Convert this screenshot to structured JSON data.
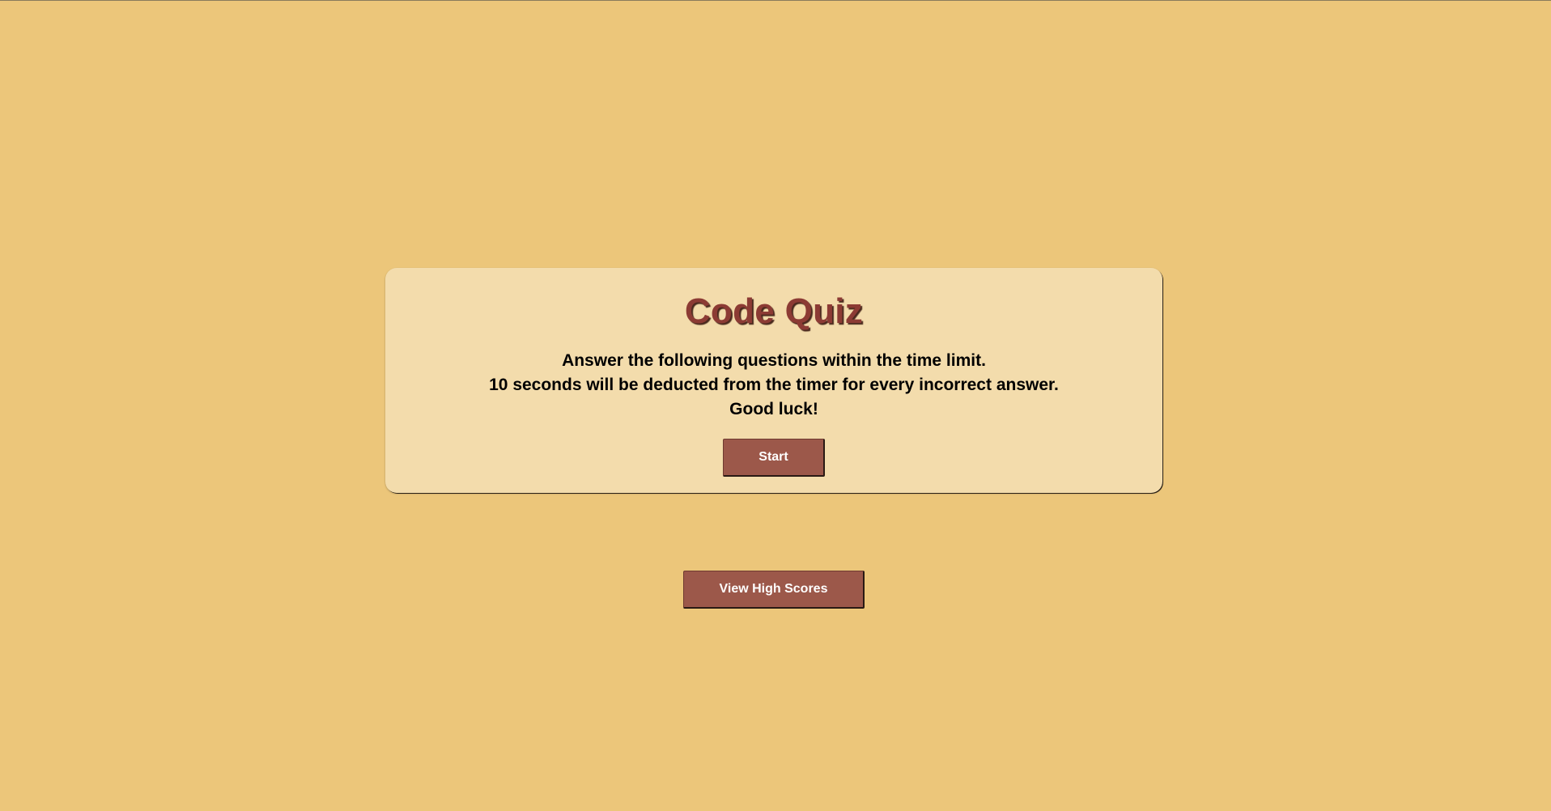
{
  "quiz_card": {
    "title": "Code Quiz",
    "instructions": [
      "Answer the following questions within the time limit.",
      "10 seconds will be deducted from the timer for every incorrect answer.",
      "Good luck!"
    ],
    "start_label": "Start"
  },
  "high_scores": {
    "button_label": "View High Scores"
  },
  "colors": {
    "background": "#ecc67a",
    "card_background": "#f3dcac",
    "title": "#8c3b34",
    "button": "#9c584a",
    "button_text": "#ffffff"
  }
}
